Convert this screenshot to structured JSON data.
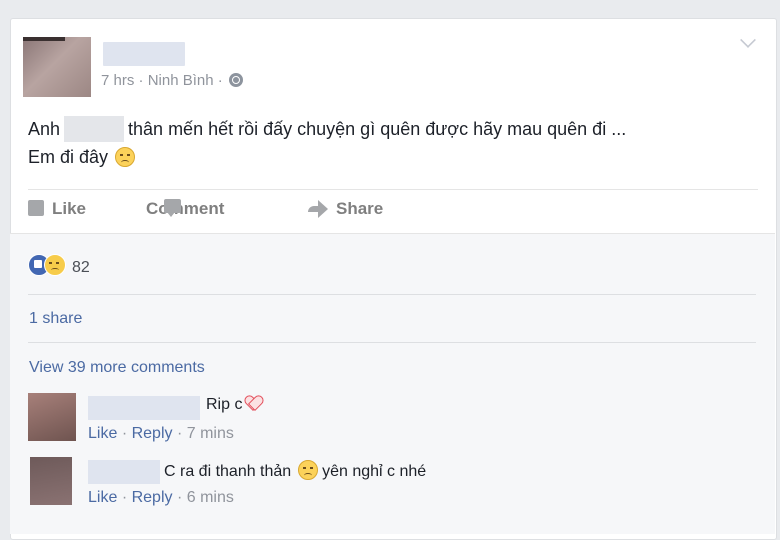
{
  "post": {
    "time": "7 hrs",
    "separator": "·",
    "location": "Ninh Bình",
    "privacy_icon": "globe-icon",
    "text_prefix": "Anh",
    "text_line1_rest": "thân mến hết rồi đấy chuyện gì quên được hãy mau quên đi ...",
    "text_line2": "Em đi đây",
    "text_emoji": "sad-face-emoji"
  },
  "actions": {
    "like_label": "Like",
    "comment_label": "Comment",
    "share_label": "Share"
  },
  "stats": {
    "reaction_count": "82",
    "share_count": "1 share"
  },
  "comments": {
    "view_more": "View 39 more comments",
    "items": [
      {
        "text": "Rip c",
        "emoji": "heart-icon",
        "like": "Like",
        "reply": "Reply",
        "time": "7 mins"
      },
      {
        "text_before": "C ra đi thanh thản",
        "emoji": "sad-face-emoji",
        "text_after": "yên nghỉ c nhé",
        "like": "Like",
        "reply": "Reply",
        "time": "6 mins"
      }
    ]
  },
  "colors": {
    "link": "#4b6aa3",
    "meta": "#90949c",
    "action": "#7f7f7f",
    "like_blue": "#4267b2"
  }
}
